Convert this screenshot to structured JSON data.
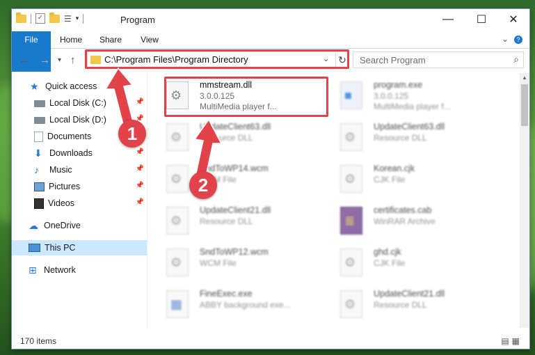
{
  "window": {
    "title": "Program"
  },
  "tabs": [
    {
      "label": "File"
    },
    {
      "label": "Home"
    },
    {
      "label": "Share"
    },
    {
      "label": "View"
    }
  ],
  "address": {
    "path": "C:\\Program Files\\Program Directory"
  },
  "search": {
    "placeholder": "Search Program"
  },
  "sidebar": {
    "items": [
      {
        "label": "Quick access"
      },
      {
        "label": "Local Disk (C:)"
      },
      {
        "label": "Local Disk (D:)"
      },
      {
        "label": "Documents"
      },
      {
        "label": "Downloads"
      },
      {
        "label": "Music"
      },
      {
        "label": "Pictures"
      },
      {
        "label": "Videos"
      },
      {
        "label": "OneDrive"
      },
      {
        "label": "This PC"
      },
      {
        "label": "Network"
      }
    ]
  },
  "files": [
    {
      "name": "mmstream.dll",
      "line2": "3.0.0.125",
      "line3": "MultiMedia player f..."
    },
    {
      "name": "program.exe",
      "line2": "3.0.0.125",
      "line3": "MultiMedia player f..."
    },
    {
      "name": "UpdateClient63.dll",
      "line2": "Resource DLL",
      "line3": ""
    },
    {
      "name": "UpdateClient63.dll",
      "line2": "Resource DLL",
      "line3": ""
    },
    {
      "name": "SndToWP14.wcm",
      "line2": "WCM File",
      "line3": ""
    },
    {
      "name": "Korean.cjk",
      "line2": "CJK File",
      "line3": ""
    },
    {
      "name": "UpdateClient21.dll",
      "line2": "Resource DLL",
      "line3": ""
    },
    {
      "name": "certificates.cab",
      "line2": "WinRAR Archive",
      "line3": ""
    },
    {
      "name": "SndToWP12.wcm",
      "line2": "WCM File",
      "line3": ""
    },
    {
      "name": "ghd.cjk",
      "line2": "CJK File",
      "line3": ""
    },
    {
      "name": "FineExec.exe",
      "line2": "ABBY background exe...",
      "line3": ""
    },
    {
      "name": "UpdateClient21.dll",
      "line2": "Resource DLL",
      "line3": ""
    }
  ],
  "status": {
    "count": "170 items"
  },
  "callouts": [
    "1",
    "2"
  ],
  "colors": {
    "accent": "#1979ca",
    "highlight": "#e2424a",
    "selection": "#cce8ff"
  }
}
